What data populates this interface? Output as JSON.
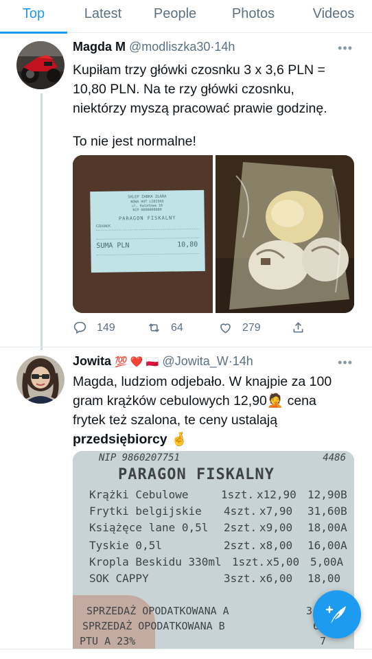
{
  "tabs": [
    {
      "label": "Top",
      "active": true
    },
    {
      "label": "Latest"
    },
    {
      "label": "People"
    },
    {
      "label": "Photos"
    },
    {
      "label": "Videos"
    }
  ],
  "tweet1": {
    "name": "Magda M",
    "handle": "@modliszka30",
    "separator": "·",
    "time": "14h",
    "more": "•••",
    "text_lines": [
      "Kupiłam trzy główki czosnku 3 x 3,6 PLN =",
      "10,80 PLN. Na te rzy główki czosnku,",
      "niektórzy myszą pracować prawie godzinę.",
      "To nie jest normalne!"
    ],
    "receipt": {
      "shop_line1": "SKLEP ŻABKA ZŁARA",
      "shop_line2": "NOWA HUT LIBISKO",
      "shop_line3": "ul. Kwiatowa 18",
      "shop_line4": "NIP 0000000000",
      "title": "PARAGON FISKALNY",
      "item": "CZOSNEK",
      "total_label": "SUMA PLN",
      "total_value": "10,80"
    },
    "replies": "149",
    "retweets": "64",
    "likes": "279"
  },
  "tweet2": {
    "name": "Jowita",
    "name_emoji": "💯 ❤️ 🇵🇱",
    "handle": "@Jowita_W",
    "separator": "·",
    "time": "14h",
    "more": "•••",
    "text_lines": [
      "Magda, ludziom odjebało. W knajpie za 100",
      "gram krążków cebulowych  12,90🤦 cena",
      "frytek też szalona, te ceny ustalają",
      "przedsiębiorcy 🤞"
    ],
    "receipt": {
      "nip": "NIP 9860207751",
      "nip_right": "4486",
      "title": "PARAGON FISKALNY",
      "items": [
        {
          "name": "Krążki Cebulowe",
          "qty": "1szt.",
          "price": "x12,90",
          "total": "12,90B"
        },
        {
          "name": "Frytki belgijskie",
          "qty": "4szt.",
          "price": "x7,90",
          "total": "31,60B"
        },
        {
          "name": "Książęce lane 0,5l",
          "qty": "2szt.",
          "price": "x9,00",
          "total": "18,00A"
        },
        {
          "name": "Tyskie 0,5l",
          "qty": "2szt.",
          "price": "x8,00",
          "total": "16,00A"
        },
        {
          "name": "Kropla Beskidu 330ml",
          "qty": "1szt.",
          "price": "x5,00",
          "total": "5,00A"
        },
        {
          "name": "SOK CAPPY",
          "qty": "3szt.",
          "price": "x6,00",
          "total": "18,00"
        }
      ],
      "footer_lines": [
        "SPRZEDAŻ OPODATKOWANA A",
        "SPRZEDAŻ OPODATKOWANA B",
        "PTU A 23%"
      ],
      "footer_values": [
        "3",
        "62",
        "7"
      ]
    }
  },
  "colors": {
    "accent": "#1d9bf0",
    "text": "#0f1419",
    "secondary": "#5b7083",
    "divider": "#e6ecf0"
  },
  "icons": {
    "reply": "speech-bubble-icon",
    "retweet": "retweet-icon",
    "like": "heart-icon",
    "share": "share-icon",
    "compose": "feather-plus-icon"
  }
}
